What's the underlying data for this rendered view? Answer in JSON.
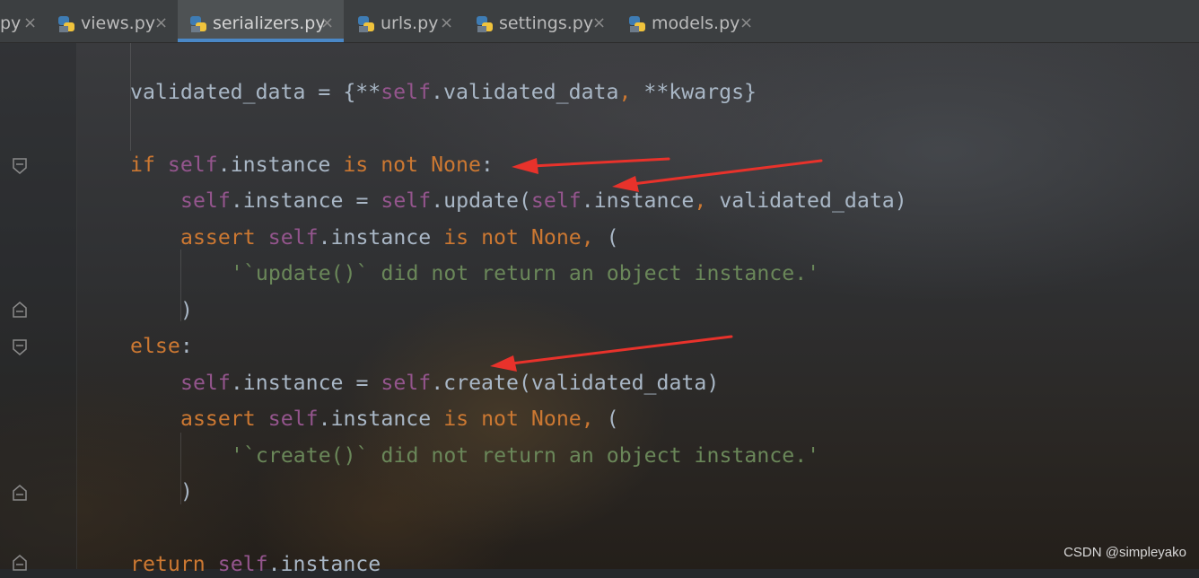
{
  "tabs": [
    {
      "label": "py",
      "icon": "python-file-icon",
      "active": false
    },
    {
      "label": "views.py",
      "icon": "python-file-icon",
      "active": false
    },
    {
      "label": "serializers.py",
      "icon": "python-file-icon",
      "active": true
    },
    {
      "label": "urls.py",
      "icon": "python-file-icon",
      "active": false
    },
    {
      "label": "settings.py",
      "icon": "python-file-icon",
      "active": false
    },
    {
      "label": "models.py",
      "icon": "python-file-icon",
      "active": false
    }
  ],
  "tab_close_glyph": "×",
  "code": {
    "l1": {
      "a": "validated_data = {**",
      "b": "self",
      "c": ".validated_data",
      "d": ",",
      "e": " **kwargs}"
    },
    "l2": {
      "a": "if ",
      "b": "self",
      "c": ".instance ",
      "d": "is not None",
      "e": ":"
    },
    "l3": {
      "a": "self",
      "b": ".instance = ",
      "c": "self",
      "d": ".update(",
      "e": "self",
      "f": ".instance",
      "g": ",",
      "h": " validated_data)"
    },
    "l4": {
      "a": "assert ",
      "b": "self",
      "c": ".instance ",
      "d": "is not None",
      "e": ",",
      "f": " ("
    },
    "l5": {
      "a": "'`update()` did not return an object instance.'"
    },
    "l6": {
      "a": ")"
    },
    "l7": {
      "a": "else",
      "b": ":"
    },
    "l8": {
      "a": "self",
      "b": ".instance = ",
      "c": "self",
      "d": ".create(validated_data)"
    },
    "l9": {
      "a": "assert ",
      "b": "self",
      "c": ".instance ",
      "d": "is not None",
      "e": ",",
      "f": " ("
    },
    "l10": {
      "a": "'`create()` did not return an object instance.'"
    },
    "l11": {
      "a": ")"
    },
    "l12": {
      "a": "return ",
      "b": "self",
      "c": ".instance"
    }
  },
  "colors": {
    "keyword": "#cc7832",
    "self": "#94558d",
    "string": "#6a8759",
    "text": "#a9b7c6",
    "active_tab_underline": "#4a88c7",
    "arrow": "#e8322b"
  },
  "watermark": "CSDN @simpleyako"
}
